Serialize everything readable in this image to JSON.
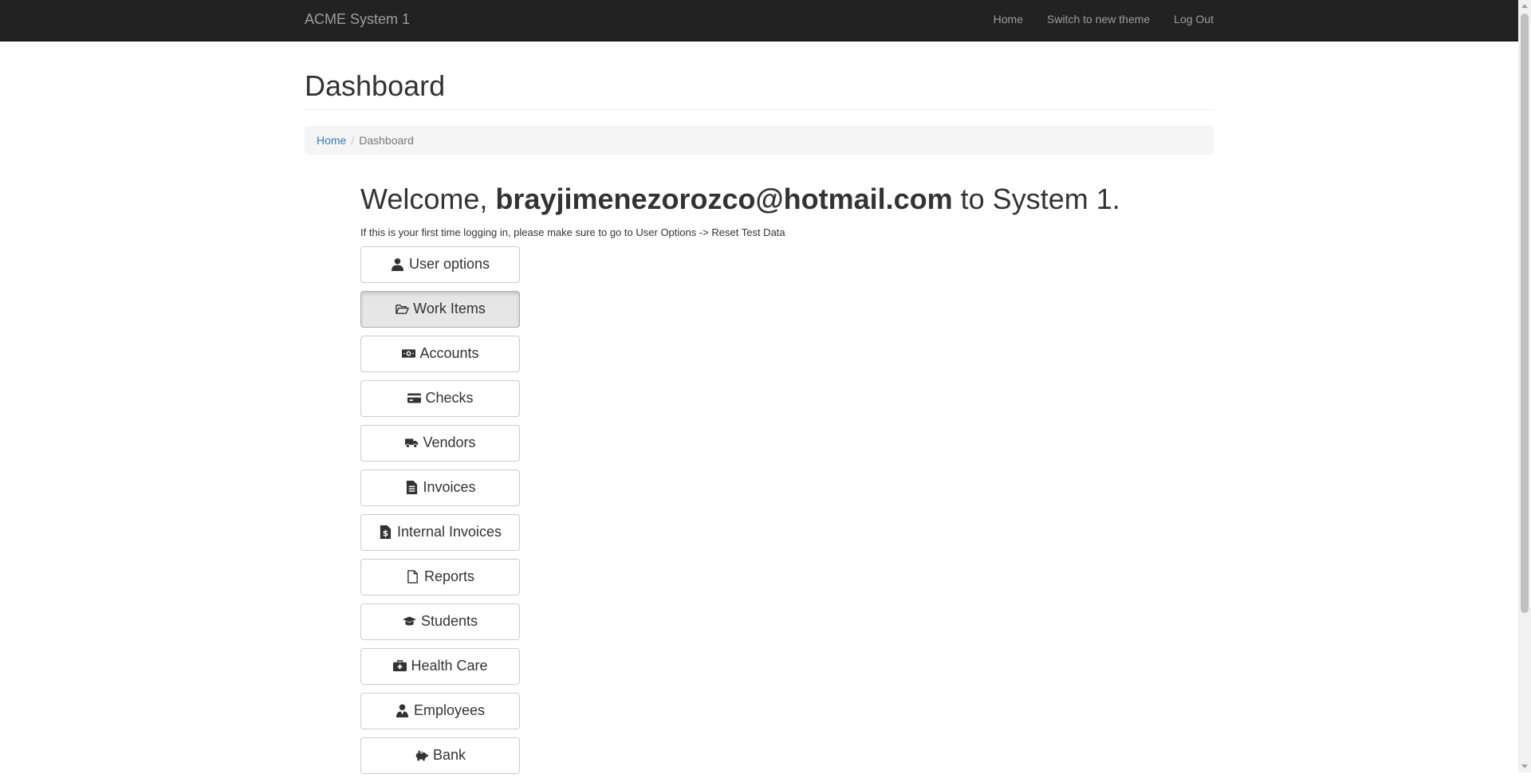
{
  "navbar": {
    "brand": "ACME System 1",
    "links": [
      "Home",
      "Switch to new theme",
      "Log Out"
    ]
  },
  "page": {
    "title": "Dashboard"
  },
  "breadcrumb": {
    "home": "Home",
    "separator": "/",
    "current": "Dashboard"
  },
  "welcome": {
    "prefix": "Welcome,",
    "user": "brayjimenezorozco@hotmail.com",
    "suffix": "to System 1.",
    "note": "If this is your first time logging in, please make sure to go to User Options -> Reset Test Data"
  },
  "buttons": [
    {
      "label": "User options",
      "icon": "user-icon"
    },
    {
      "label": "Work Items",
      "icon": "folder-open-icon",
      "state": "active"
    },
    {
      "label": "Accounts",
      "icon": "money-bill-icon"
    },
    {
      "label": "Checks",
      "icon": "credit-card-icon"
    },
    {
      "label": "Vendors",
      "icon": "truck-icon"
    },
    {
      "label": "Invoices",
      "icon": "file-text-icon"
    },
    {
      "label": "Internal Invoices",
      "icon": "file-invoice-dollar-icon"
    },
    {
      "label": "Reports",
      "icon": "file-icon"
    },
    {
      "label": "Students",
      "icon": "graduation-cap-icon"
    },
    {
      "label": "Health Care",
      "icon": "medkit-icon"
    },
    {
      "label": "Employees",
      "icon": "user-tie-icon"
    },
    {
      "label": "Bank",
      "icon": "piggy-bank-icon"
    }
  ],
  "colors": {
    "navbar_bg": "#222222",
    "navbar_text": "#9d9d9d",
    "link": "#337ab7",
    "breadcrumb_bg": "#f5f5f5",
    "button_border": "#cccccc",
    "active_button_bg": "#e6e6e6"
  }
}
